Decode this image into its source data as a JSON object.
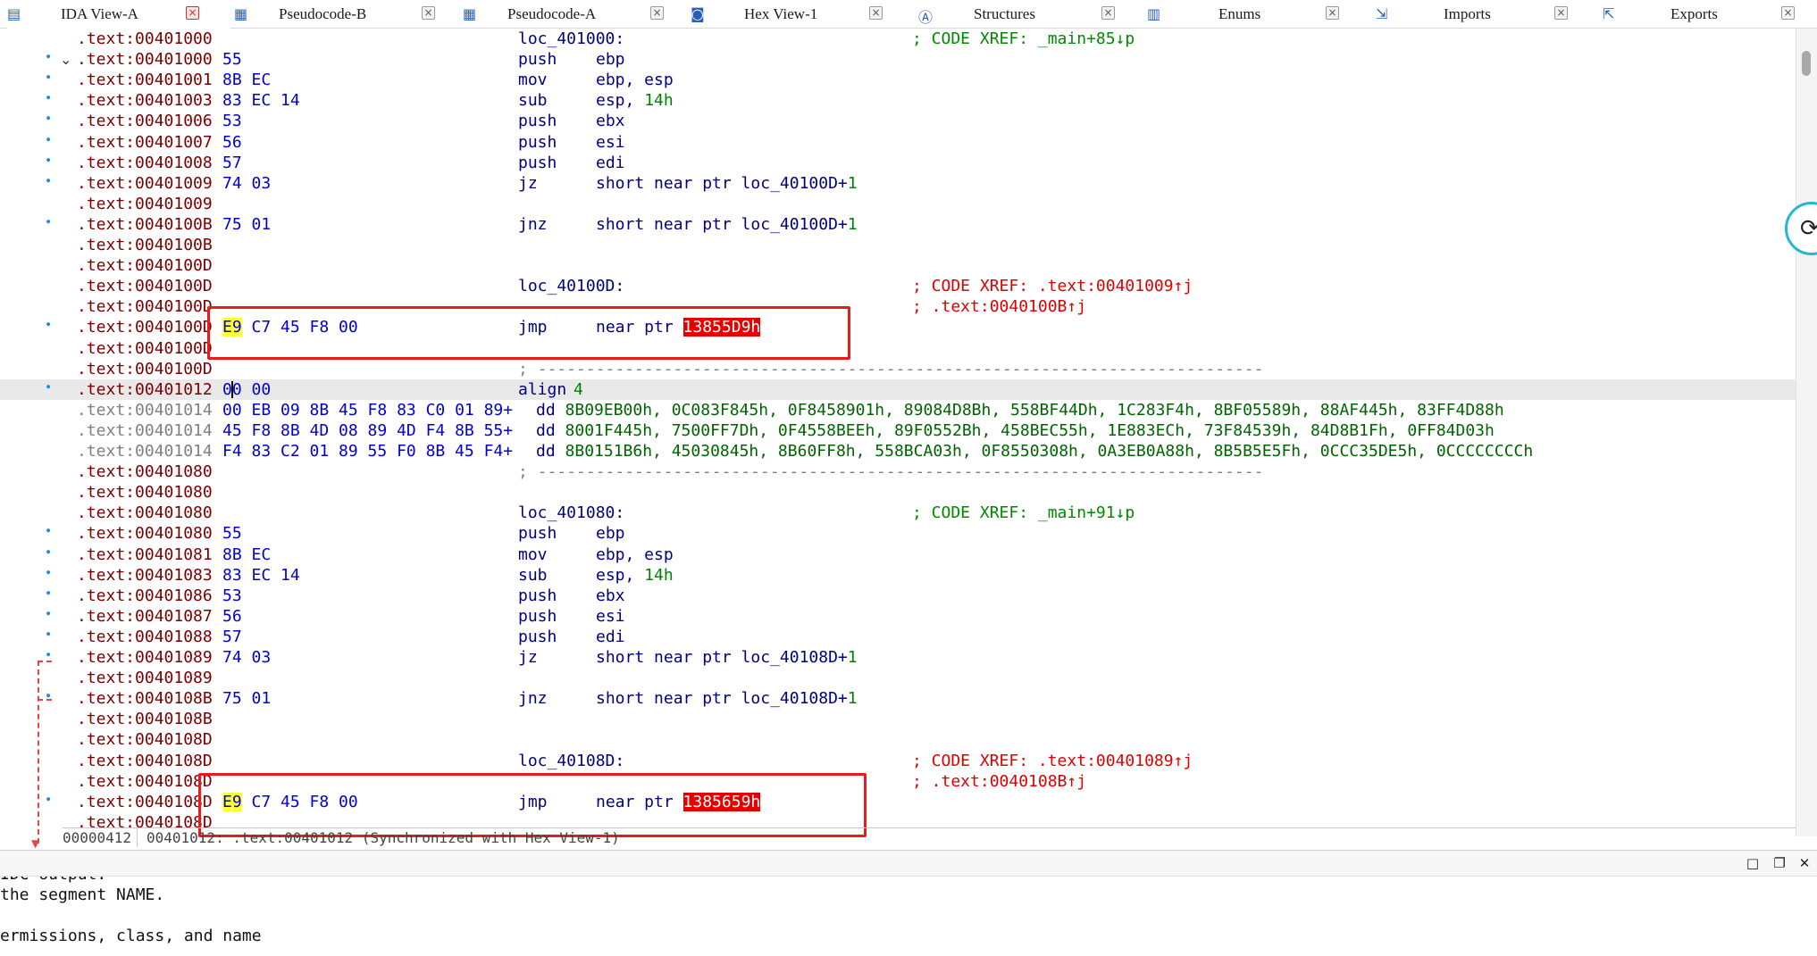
{
  "tabs": [
    {
      "label": "IDA View-A",
      "active": true,
      "icon": "ida-view-icon"
    },
    {
      "label": "Pseudocode-B",
      "active": false,
      "icon": "pseudocode-icon"
    },
    {
      "label": "Pseudocode-A",
      "active": false,
      "icon": "pseudocode-icon"
    },
    {
      "label": "Hex View-1",
      "active": false,
      "icon": "hex-view-icon"
    },
    {
      "label": "Structures",
      "active": false,
      "icon": "structures-icon"
    },
    {
      "label": "Enums",
      "active": false,
      "icon": "enums-icon"
    },
    {
      "label": "Imports",
      "active": false,
      "icon": "imports-icon"
    },
    {
      "label": "Exports",
      "active": false,
      "icon": "exports-icon"
    }
  ],
  "listing": [
    {
      "addr": ".text:00401000",
      "label": "loc_401000:",
      "comment": "; CODE XREF: _main+85↓p",
      "comment_color": "green"
    },
    {
      "addr": ".text:00401000",
      "bytes": "55",
      "mnem": "push",
      "ops": "ebp",
      "dot": true,
      "chevron": true
    },
    {
      "addr": ".text:00401001",
      "bytes": "8B EC",
      "mnem": "mov",
      "ops": "ebp, esp",
      "dot": true
    },
    {
      "addr": ".text:00401003",
      "bytes": "83 EC 14",
      "mnem": "sub",
      "ops": "esp, ",
      "num": "14h",
      "dot": true
    },
    {
      "addr": ".text:00401006",
      "bytes": "53",
      "mnem": "push",
      "ops": "ebx",
      "dot": true
    },
    {
      "addr": ".text:00401007",
      "bytes": "56",
      "mnem": "push",
      "ops": "esi",
      "dot": true
    },
    {
      "addr": ".text:00401008",
      "bytes": "57",
      "mnem": "push",
      "ops": "edi",
      "dot": true
    },
    {
      "addr": ".text:00401009",
      "bytes": "74 03",
      "mnem": "jz",
      "ops": "short near ptr loc_40100D+",
      "num": "1",
      "dot": true
    },
    {
      "addr": ".text:00401009"
    },
    {
      "addr": ".text:0040100B",
      "bytes": "75 01",
      "mnem": "jnz",
      "ops": "short near ptr loc_40100D+",
      "num": "1",
      "dot": true
    },
    {
      "addr": ".text:0040100B"
    },
    {
      "addr": ".text:0040100D"
    },
    {
      "addr": ".text:0040100D",
      "label": "loc_40100D:",
      "comment": "; CODE XREF: .text:00401009↑j",
      "comment_color": "red"
    },
    {
      "addr": ".text:0040100D",
      "comment": "; .text:0040100B↑j",
      "comment_color": "red"
    },
    {
      "addr": ".text:0040100D",
      "bytes_hl": "E9",
      "bytes": " C7 45 F8 00",
      "mnem": "jmp",
      "ops": "near ptr ",
      "redtarget": "13855D9h",
      "dot": true
    },
    {
      "addr": ".text:0040100D"
    },
    {
      "addr": ".text:0040100D",
      "separator": "; ---------------------------------------------------------------------------"
    },
    {
      "addr": ".text:00401012",
      "bytes_caret": "00",
      "bytes": " 00",
      "mnem": "align",
      "num_only": "4",
      "dot": true,
      "highlight": true
    },
    {
      "addr": ".text:00401014",
      "data": true,
      "bytes": "00 EB 09 8B 45 F8 83 C0 01 89",
      "dd": "8B09EB00h, 0C083F845h, 0F8458901h, 89084D8Bh, 558BF44Dh, 1C283F4h, 8BF05589h, 88AF445h, 83FF4D88h"
    },
    {
      "addr": ".text:00401014",
      "data": true,
      "bytes": "45 F8 8B 4D 08 89 4D F4 8B 55",
      "dd": "8001F445h, 7500FF7Dh, 0F4558BEEh, 89F0552Bh, 458BEC55h, 1E883ECh, 73F84539h, 84D8B1Fh, 0FF84D03h"
    },
    {
      "addr": ".text:00401014",
      "data": true,
      "bytes": "F4 83 C2 01 89 55 F0 8B 45 F4",
      "dd": "8B0151B6h, 45030845h, 8B60FF8h, 558BCA03h, 0F8550308h, 0A3EB0A88h, 8B5B5E5Fh, 0CCC35DE5h, 0CCCCCCCCh"
    },
    {
      "addr": ".text:00401080",
      "separator": "; ---------------------------------------------------------------------------"
    },
    {
      "addr": ".text:00401080"
    },
    {
      "addr": ".text:00401080",
      "label": "loc_401080:",
      "comment": "; CODE XREF: _main+91↓p",
      "comment_color": "green"
    },
    {
      "addr": ".text:00401080",
      "bytes": "55",
      "mnem": "push",
      "ops": "ebp",
      "dot": true
    },
    {
      "addr": ".text:00401081",
      "bytes": "8B EC",
      "mnem": "mov",
      "ops": "ebp, esp",
      "dot": true
    },
    {
      "addr": ".text:00401083",
      "bytes": "83 EC 14",
      "mnem": "sub",
      "ops": "esp, ",
      "num": "14h",
      "dot": true
    },
    {
      "addr": ".text:00401086",
      "bytes": "53",
      "mnem": "push",
      "ops": "ebx",
      "dot": true
    },
    {
      "addr": ".text:00401087",
      "bytes": "56",
      "mnem": "push",
      "ops": "esi",
      "dot": true
    },
    {
      "addr": ".text:00401088",
      "bytes": "57",
      "mnem": "push",
      "ops": "edi",
      "dot": true
    },
    {
      "addr": ".text:00401089",
      "bytes": "74 03",
      "mnem": "jz",
      "ops": "short near ptr loc_40108D+",
      "num": "1",
      "dot": true
    },
    {
      "addr": ".text:00401089"
    },
    {
      "addr": ".text:0040108B",
      "bytes": "75 01",
      "mnem": "jnz",
      "ops": "short near ptr loc_40108D+",
      "num": "1",
      "dot": true
    },
    {
      "addr": ".text:0040108B"
    },
    {
      "addr": ".text:0040108D"
    },
    {
      "addr": ".text:0040108D",
      "label": "loc_40108D:",
      "comment": "; CODE XREF: .text:00401089↑j",
      "comment_color": "red"
    },
    {
      "addr": ".text:0040108D",
      "comment": "; .text:0040108B↑j",
      "comment_color": "red"
    },
    {
      "addr": ".text:0040108D",
      "bytes_hl": "E9",
      "bytes": " C7 45 F8 00",
      "mnem": "jmp",
      "ops": "near ptr ",
      "redtarget": "1385659h",
      "dot": true
    },
    {
      "addr": ".text:0040108D"
    }
  ],
  "status": {
    "offset": "00000412",
    "text": "00401012: .text:00401012 (Synchronized with Hex View-1)"
  },
  "output": {
    "lines": [
      "IDC output:",
      "the segment NAME.",
      "",
      "ermissions, class, and name"
    ]
  }
}
